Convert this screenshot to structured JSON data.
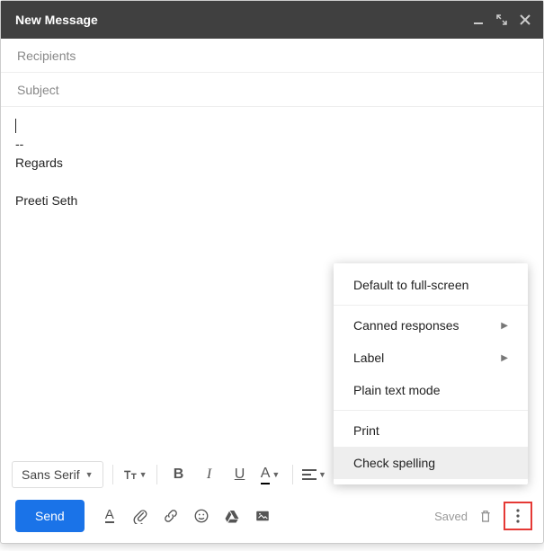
{
  "header": {
    "title": "New Message"
  },
  "fields": {
    "recipients_placeholder": "Recipients",
    "subject_placeholder": "Subject"
  },
  "body": {
    "sig_sep": "--",
    "sig_line1": "Regards",
    "sig_line2": "Preeti Seth"
  },
  "format": {
    "font": "Sans Serif",
    "bold": "B",
    "italic": "I",
    "underline": "U",
    "color": "A"
  },
  "actions": {
    "send": "Send",
    "format_underline": "A",
    "saved": "Saved"
  },
  "menu": {
    "fullscreen": "Default to full-screen",
    "canned": "Canned responses",
    "label": "Label",
    "plaintext": "Plain text mode",
    "print": "Print",
    "spell": "Check spelling"
  }
}
